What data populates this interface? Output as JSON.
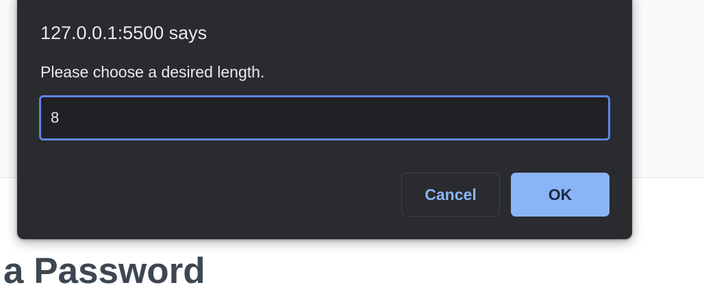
{
  "page": {
    "heading": "a Password"
  },
  "dialog": {
    "origin": "127.0.0.1:5500 says",
    "message": "Please choose a desired length.",
    "input_value": "8",
    "cancel_label": "Cancel",
    "ok_label": "OK"
  },
  "colors": {
    "dialog_background": "#2a2b2f",
    "input_focus_border": "#5b86e5",
    "ok_button": "#8ab4f8",
    "cancel_text": "#8ab4f8",
    "heading_text": "#3d4752"
  }
}
